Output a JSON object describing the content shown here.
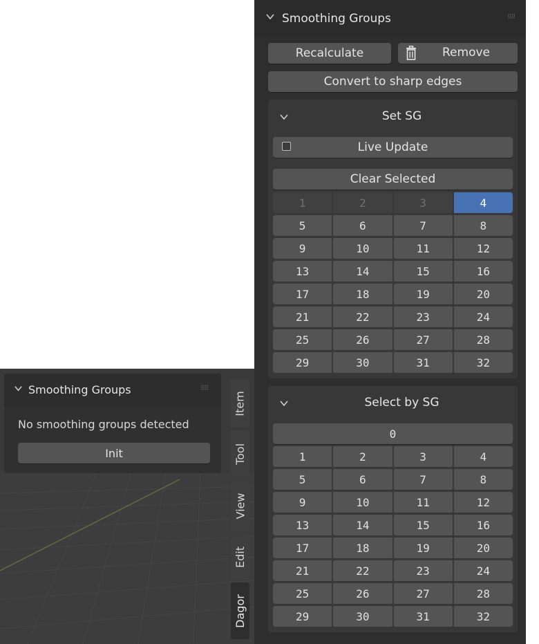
{
  "right_panel": {
    "title": "Smoothing Groups",
    "recalculate_label": "Recalculate",
    "remove_label": "Remove",
    "convert_label": "Convert to sharp edges",
    "set_sg": {
      "title": "Set SG",
      "live_update_label": "Live Update",
      "live_update_checked": false,
      "clear_selected_label": "Clear Selected",
      "cells": [
        "1",
        "2",
        "3",
        "4",
        "5",
        "6",
        "7",
        "8",
        "9",
        "10",
        "11",
        "12",
        "13",
        "14",
        "15",
        "16",
        "17",
        "18",
        "19",
        "20",
        "21",
        "22",
        "23",
        "24",
        "25",
        "26",
        "27",
        "28",
        "29",
        "30",
        "31",
        "32"
      ],
      "disabled": [
        "1",
        "2",
        "3"
      ],
      "active": "4"
    },
    "select_by_sg": {
      "title": "Select by SG",
      "zero_label": "0",
      "cells": [
        "1",
        "2",
        "3",
        "4",
        "5",
        "6",
        "7",
        "8",
        "9",
        "10",
        "11",
        "12",
        "13",
        "14",
        "15",
        "16",
        "17",
        "18",
        "19",
        "20",
        "21",
        "22",
        "23",
        "24",
        "25",
        "26",
        "27",
        "28",
        "29",
        "30",
        "31",
        "32"
      ]
    }
  },
  "left_panel": {
    "title": "Smoothing Groups",
    "message": "No smoothing groups detected",
    "init_label": "Init"
  },
  "tabs": [
    {
      "label": "Item",
      "active": false
    },
    {
      "label": "Tool",
      "active": false
    },
    {
      "label": "View",
      "active": false
    },
    {
      "label": "Edit",
      "active": false
    },
    {
      "label": "Dagor",
      "active": true
    }
  ],
  "icons": {
    "chevron": "chevron-down-icon",
    "grip": "drag-grip-icon",
    "trash": "trash-icon",
    "checkbox": "checkbox-icon"
  },
  "colors": {
    "accent": "#4772b3",
    "panel": "#2e2e2e",
    "button": "#545454"
  }
}
